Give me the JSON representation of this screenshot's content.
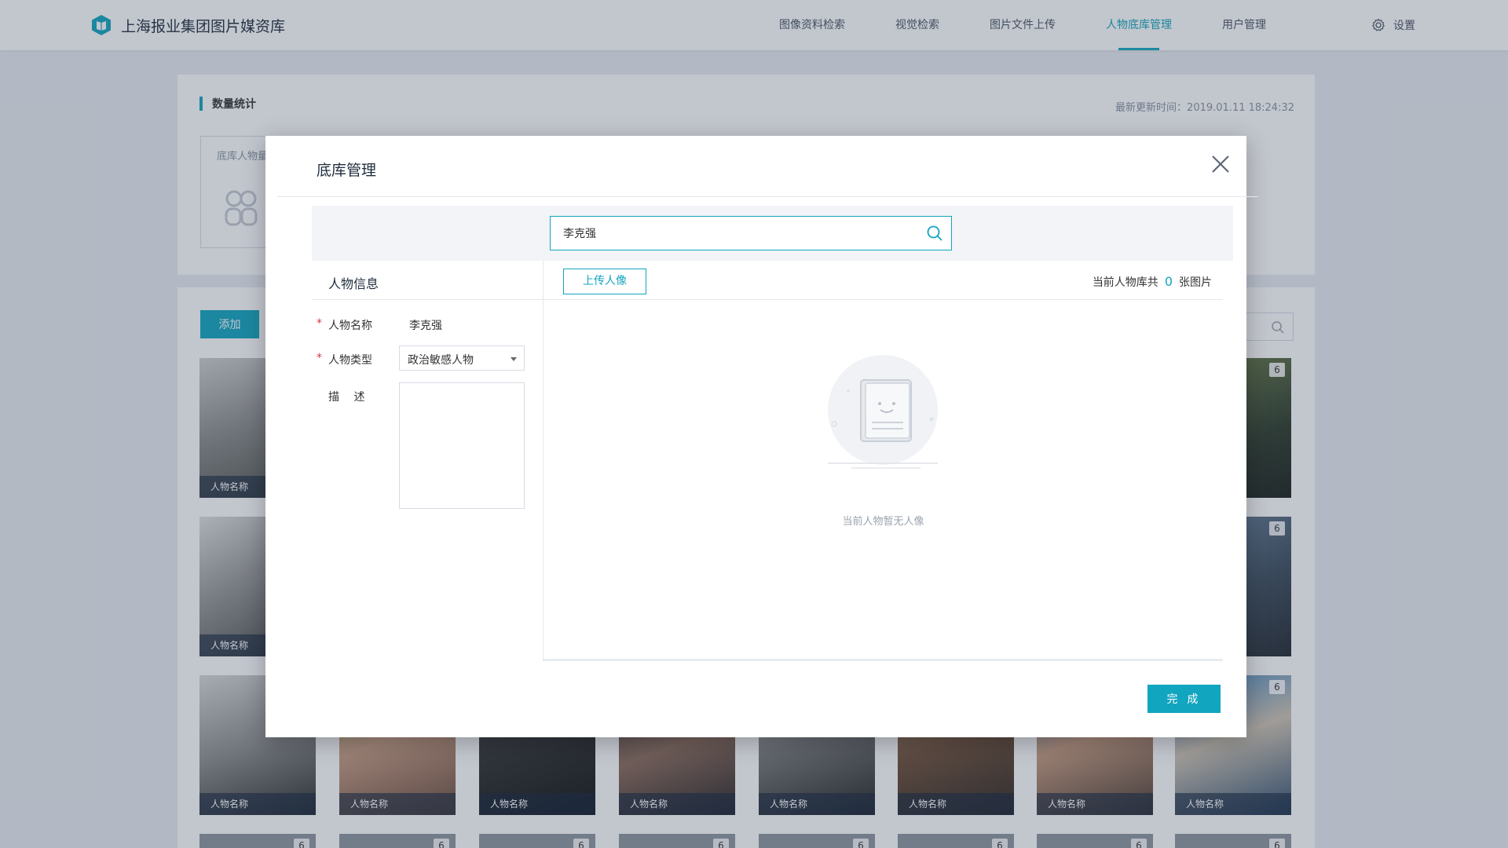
{
  "app": {
    "title": "上海报业集团图片媒资库",
    "nav": [
      "图像资料检索",
      "视觉检索",
      "图片文件上传",
      "人物底库管理",
      "用户管理"
    ],
    "active_nav": "人物底库管理",
    "settings_label": "设置",
    "accent_color": "#12a5bf"
  },
  "stats": {
    "title": "数量统计",
    "update_time": "最新更新时间：2019.01.11 18:24:32",
    "box_label": "底库人物量"
  },
  "list": {
    "add_label": "添加",
    "person_label": "人物名称",
    "badge_count": "6",
    "labeled_photos": [
      {
        "label": "人物名称",
        "badge": "6"
      },
      {
        "label": "人物名称",
        "badge": "6"
      },
      {
        "label": "人物名称",
        "badge": "6"
      },
      {
        "label": "人物名称",
        "badge": ""
      },
      {
        "label": "人物名称",
        "badge": ""
      },
      {
        "label": "人物名称",
        "badge": ""
      },
      {
        "label": "人物名称",
        "badge": ""
      },
      {
        "label": "人物名称",
        "badge": ""
      },
      {
        "label": "人物名称",
        "badge": ""
      },
      {
        "label": "人物名称",
        "badge": ""
      },
      {
        "label": "人物名称",
        "badge": "6"
      }
    ],
    "bottom_badges": [
      "6",
      "6",
      "6",
      "6",
      "6",
      "6",
      "6",
      "6"
    ]
  },
  "modal": {
    "title": "底库管理",
    "search_value": "李克强",
    "info_title": "人物信息",
    "fields": {
      "name_label": "人物名称",
      "name_value": "李克强",
      "type_label": "人物类型",
      "type_value": "政治敏感人物",
      "desc_label": "描　 述",
      "desc_value": ""
    },
    "upload_label": "上传人像",
    "count_prefix": "当前人物库共",
    "count_value": "0",
    "count_suffix": "张图片",
    "empty_text": "当前人物暂无人像",
    "done_label": "完 成"
  }
}
